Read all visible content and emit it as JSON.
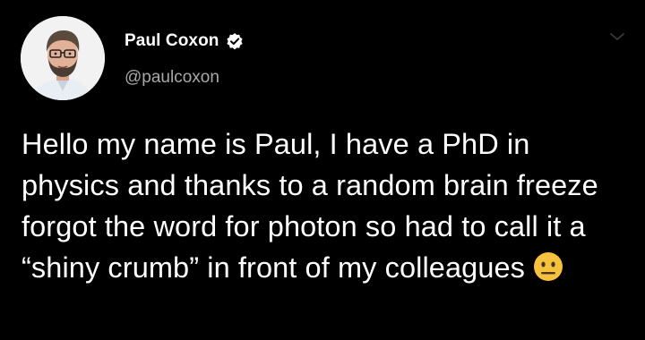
{
  "tweet": {
    "author": {
      "display_name": "Paul Coxon",
      "handle": "@paulcoxon",
      "verified": true
    },
    "text": "Hello my name is Paul, I have a PhD in physics and thanks to a random brain freeze forgot the word for photon so had to call it a “shiny crumb” in front of my colleagues",
    "emoji": "neutral-face-icon"
  },
  "colors": {
    "background": "#000000",
    "text_primary": "#ffffff",
    "text_secondary": "#a8a8a8",
    "emoji_yellow": "#f6c13c"
  }
}
